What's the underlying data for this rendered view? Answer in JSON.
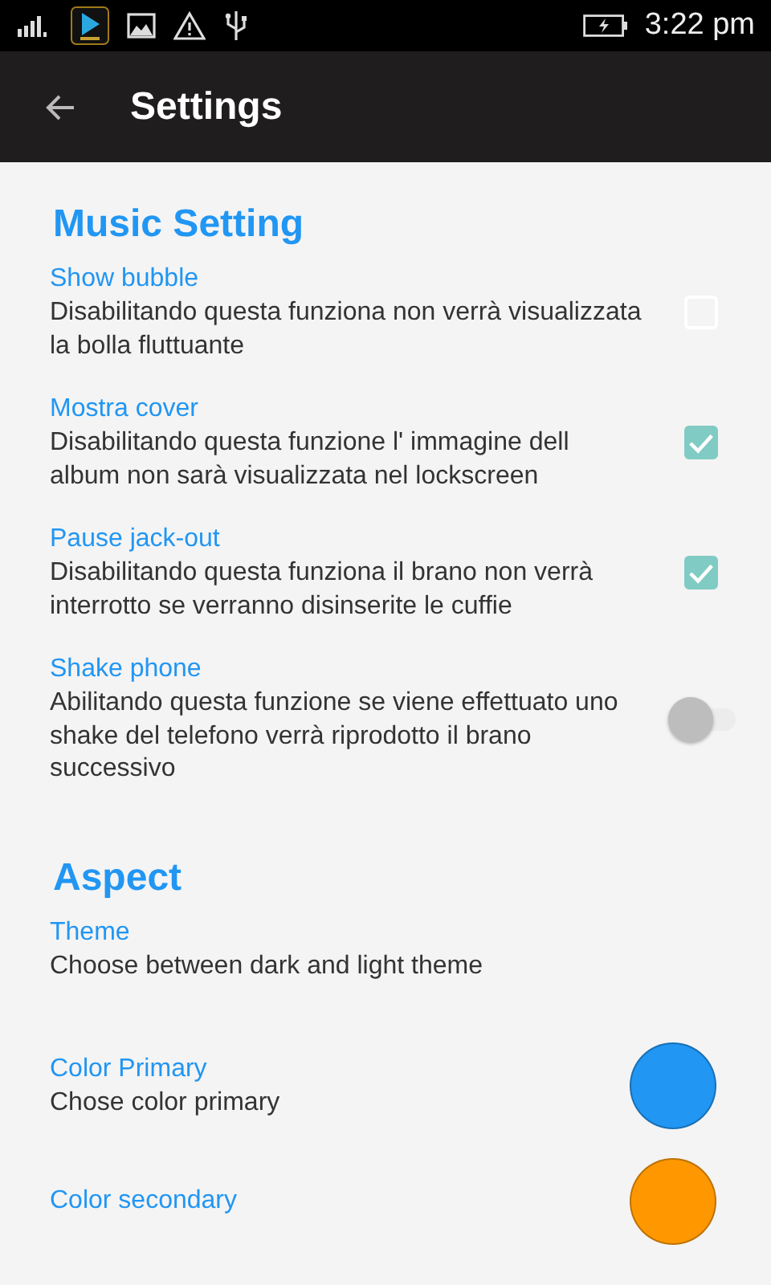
{
  "status_bar": {
    "time": "3:22 pm"
  },
  "app_bar": {
    "title": "Settings"
  },
  "sections": [
    {
      "title": "Music Setting",
      "items": [
        {
          "kind": "checkbox",
          "title": "Show bubble",
          "summary": "Disabilitando questa funziona non verrà visualizzata la bolla fluttuante",
          "checked": false
        },
        {
          "kind": "checkbox",
          "title": "Mostra cover",
          "summary": "Disabilitando questa funzione l' immagine dell album non sarà visualizzata nel lockscreen",
          "checked": true
        },
        {
          "kind": "checkbox",
          "title": "Pause jack-out",
          "summary": "Disabilitando questa funziona il brano non verrà interrotto se verranno disinserite le cuffie",
          "checked": true
        },
        {
          "kind": "switch",
          "title": "Shake phone",
          "summary": "Abilitando questa funzione se viene effettuato uno shake del telefono verrà riprodotto il brano successivo",
          "on": false
        }
      ]
    },
    {
      "title": "Aspect",
      "items": [
        {
          "kind": "plain",
          "title": "Theme",
          "summary": "Choose between dark and light theme"
        },
        {
          "kind": "color",
          "title": "Color Primary",
          "summary": "Chose color primary",
          "color": "#2196f3"
        },
        {
          "kind": "color",
          "title": "Color secondary",
          "color": "#ff9800"
        }
      ]
    }
  ]
}
